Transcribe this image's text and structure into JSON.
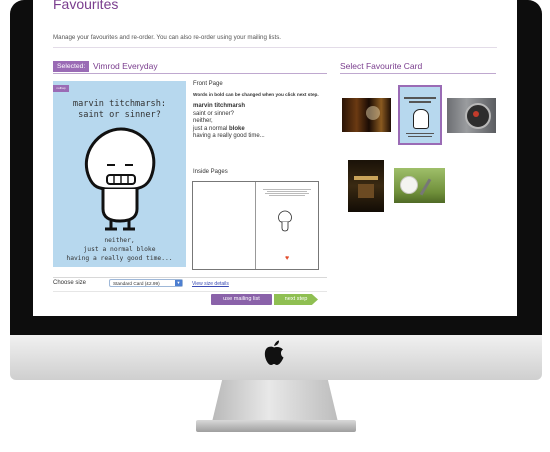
{
  "page": {
    "title": "Favourites",
    "intro": "Manage your favourites and re-order. You can also re-order using your mailing lists."
  },
  "selected": {
    "badge": "Selected:",
    "name": "Vimrod Everyday"
  },
  "favourites": {
    "heading": "Select Favourite Card",
    "thumbnails": [
      {
        "kind": "pint-glasses-photo"
      },
      {
        "kind": "marvin-card",
        "selected": true
      },
      {
        "kind": "dartboard-photo"
      },
      {
        "kind": "film-poster"
      },
      {
        "kind": "golf-ball-photo"
      }
    ]
  },
  "card": {
    "brand_tag": "nolhap",
    "headline": "marvin titchmarsh:\nsaint or sinner?",
    "tagline": "neither,\njust a normal bloke\nhaving a really good time..."
  },
  "front_page": {
    "label": "Front Page",
    "note": "Words in bold can be changed when you click next step.",
    "lines": {
      "name": "marvin titchmarsh",
      "l2": "saint or sinner?",
      "l3": "neither,",
      "l4a": "just a normal ",
      "l4b": "bloke",
      "l5": "having a really good time..."
    }
  },
  "inside_pages": {
    "label": "Inside Pages"
  },
  "size": {
    "label": "Choose size",
    "selected": "Standard Card (£2.99)",
    "view_link": "View size details"
  },
  "buttons": {
    "mailing": "use mailing list",
    "next": "next step"
  },
  "colors": {
    "accent": "#7a3d8e",
    "card_bg": "#b7d8ee",
    "next_button": "#8fbf52",
    "mailing_button": "#8a62a9"
  }
}
